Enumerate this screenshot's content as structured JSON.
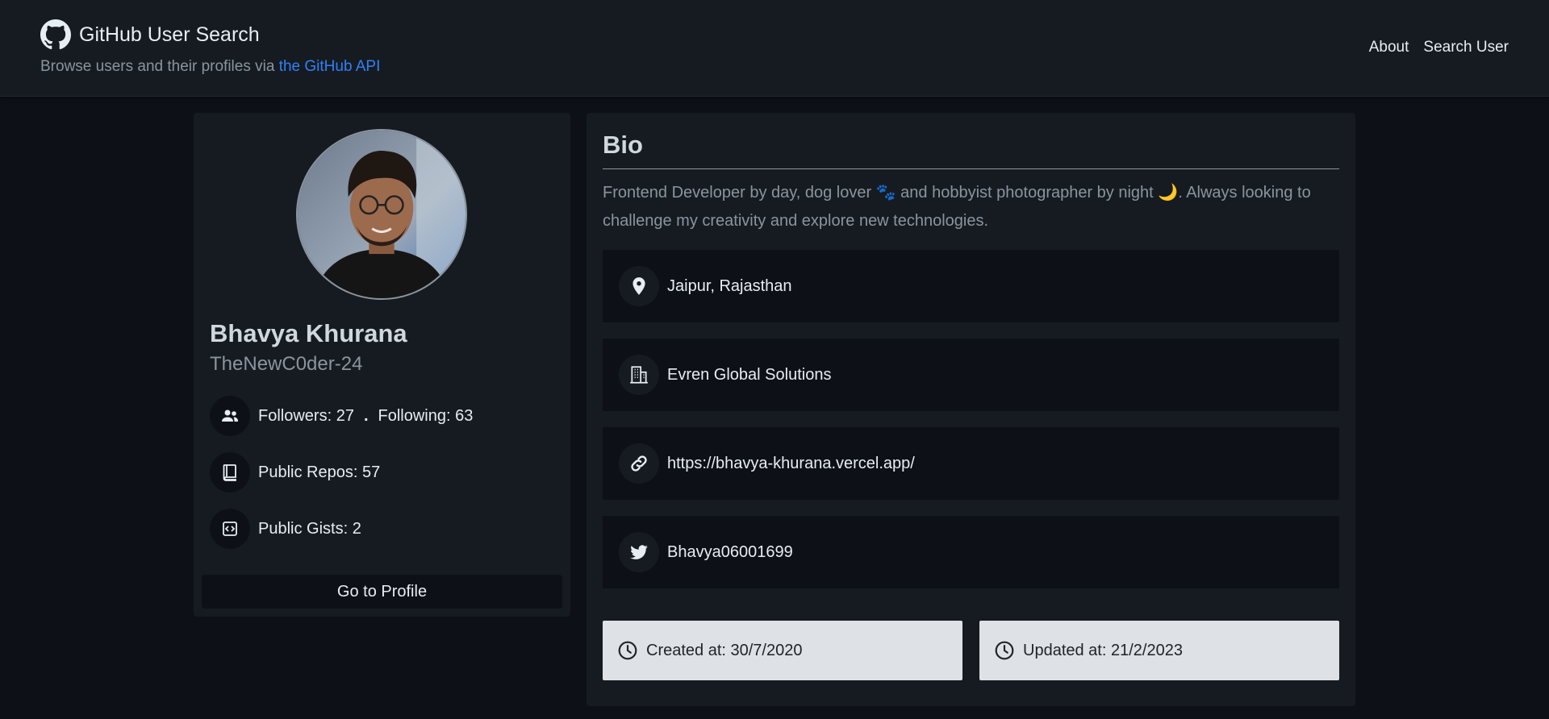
{
  "header": {
    "title": "GitHub User Search",
    "subtitle_prefix": "Browse users and their profiles via ",
    "subtitle_link": "the GitHub API",
    "nav": [
      {
        "label": "About"
      },
      {
        "label": "Search User"
      }
    ]
  },
  "profile": {
    "name": "Bhavya Khurana",
    "login": "TheNewC0der-24",
    "followers_label": "Followers: 27",
    "separator": ".",
    "following_label": "Following: 63",
    "repos_label": "Public Repos: 57",
    "gists_label": "Public Gists: 2",
    "profile_button": "Go to Profile"
  },
  "bio": {
    "title": "Bio",
    "text": "Frontend Developer by day, dog lover 🐾 and hobbyist photographer by night 🌙. Always looking to challenge my creativity and explore new technologies.",
    "location": "Jaipur, Rajasthan",
    "company": "Evren Global Solutions",
    "blog": "https://bhavya-khurana.vercel.app/",
    "twitter": "Bhavya06001699",
    "created": "Created at: 30/7/2020",
    "updated": "Updated at: 21/2/2023"
  },
  "icons": {
    "github": "github-icon",
    "followers": "people-icon",
    "repos": "repo-icon",
    "gists": "code-square-icon",
    "location": "location-pin-icon",
    "company": "building-icon",
    "blog": "link-icon",
    "twitter": "twitter-icon",
    "clock": "clock-icon"
  },
  "colors": {
    "background": "#0d1117",
    "card": "#161b22",
    "link": "#2f81f7",
    "date_box": "#dee1e5"
  }
}
